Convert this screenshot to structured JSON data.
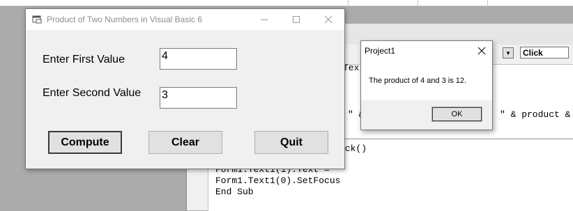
{
  "form": {
    "title": "Product of Two Numbers in Visual Basic 6",
    "label_first": "Enter First Value",
    "label_second": "Enter Second Value",
    "first_value": "4",
    "second_value": "3",
    "compute_label": "Compute",
    "clear_label": "Clear",
    "quit_label": "Quit"
  },
  "msgbox": {
    "title": "Project1",
    "message": "The product of 4 and 3 is 12.",
    "ok_label": "OK"
  },
  "code_window": {
    "procedure_combo": "Click",
    "visible_lines": [
      "Tex",
      "\" &",
      "\" & product &",
      "ick()",
      "\"",
      "Form1.Text1(1).Text = \"\"",
      "Form1.Text1(0).SetFocus",
      "End Sub"
    ]
  },
  "icons": {
    "app_icon": "vb-form-icon",
    "minimize": "minimize-icon",
    "maximize": "maximize-icon",
    "close": "close-icon",
    "dropdown": "chevron-down-icon"
  }
}
